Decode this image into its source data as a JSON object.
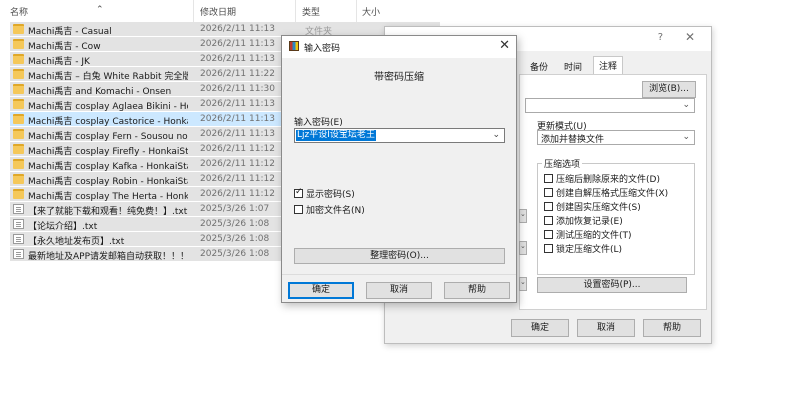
{
  "explorer": {
    "columns": [
      "名称",
      "修改日期",
      "类型",
      "大小"
    ],
    "rows": [
      {
        "name": "Machi禹吉 - Casual",
        "date": "2026/2/11 11:13",
        "type": "文件夹",
        "icon": "folder-icon"
      },
      {
        "name": "Machi禹吉 - Cow",
        "date": "2026/2/11 11:13",
        "type": "",
        "icon": "folder-icon"
      },
      {
        "name": "Machi禹吉 - JK",
        "date": "2026/2/11 11:13",
        "type": "",
        "icon": "folder-icon"
      },
      {
        "name": "Machi禹吉 – 白兔 White Rabbit 完全版",
        "date": "2026/2/11 11:22",
        "type": "",
        "icon": "folder-icon"
      },
      {
        "name": "Machi禹吉 and Komachi - Onsen",
        "date": "2026/2/11 11:30",
        "type": "",
        "icon": "folder-icon"
      },
      {
        "name": "Machi禹吉 cosplay Aglaea Bikini - Ho...",
        "date": "2026/2/11 11:13",
        "type": "",
        "icon": "folder-icon"
      },
      {
        "name": "Machi禹吉 cosplay Castorice - Honka...",
        "date": "2026/2/11 11:13",
        "type": "",
        "icon": "folder-icon"
      },
      {
        "name": "Machi禹吉 cosplay Fern - Sousou no ...",
        "date": "2026/2/11 11:13",
        "type": "",
        "icon": "folder-icon"
      },
      {
        "name": "Machi禹吉 cosplay Firefly - HonkaiSta...",
        "date": "2026/2/11 11:12",
        "type": "",
        "icon": "folder-icon"
      },
      {
        "name": "Machi禹吉 cosplay Kafka - HonkaiSta...",
        "date": "2026/2/11 11:12",
        "type": "",
        "icon": "folder-icon"
      },
      {
        "name": "Machi禹吉 cosplay Robin - HonkaiSta...",
        "date": "2026/2/11 11:12",
        "type": "",
        "icon": "folder-icon"
      },
      {
        "name": "Machi禹吉 cosplay The Herta - Honk...",
        "date": "2026/2/11 11:12",
        "type": "",
        "icon": "folder-icon"
      },
      {
        "name": "【来了就能下载和观看！纯免费！】.txt",
        "date": "2025/3/26 1:07",
        "type": "",
        "icon": "text-file-icon"
      },
      {
        "name": "【论坛介绍】.txt",
        "date": "2025/3/26 1:08",
        "type": "",
        "icon": "text-file-icon"
      },
      {
        "name": "【永久地址发布页】.txt",
        "date": "2025/3/26 1:08",
        "type": "",
        "icon": "text-file-icon"
      },
      {
        "name": "最新地址及APP请发邮箱自动获取！！！ ...",
        "date": "2025/3/26 1:08",
        "type": "",
        "icon": "text-file-icon"
      }
    ]
  },
  "back_dialog": {
    "help": "?",
    "close": "✕",
    "tabs": [
      "备份",
      "时间",
      "注释"
    ],
    "browse_button": "浏览(B)...",
    "update_mode_label": "更新模式(U)",
    "update_mode_value": "添加并替换文件",
    "options_title": "压缩选项",
    "options": [
      "压缩后删除原来的文件(D)",
      "创建自解压格式压缩文件(X)",
      "创建固实压缩文件(S)",
      "添加恢复记录(E)",
      "测试压缩的文件(T)",
      "锁定压缩文件(L)"
    ],
    "set_password_button": "设置密码(P)...",
    "ok_button": "确定",
    "cancel_button": "取消",
    "help_button": "帮助"
  },
  "password_dialog": {
    "title": "输入密码",
    "heading": "带密码压缩",
    "password_label": "输入密码(E)",
    "password_value": "Ljz平设I设宝坛老王",
    "show_password_label": "显示密码(S)",
    "show_password_checked": true,
    "encrypt_names_label": "加密文件名(N)",
    "encrypt_names_checked": false,
    "organize_button": "整理密码(O)...",
    "ok_button": "确定",
    "cancel_button": "取消",
    "help_button": "帮助"
  }
}
